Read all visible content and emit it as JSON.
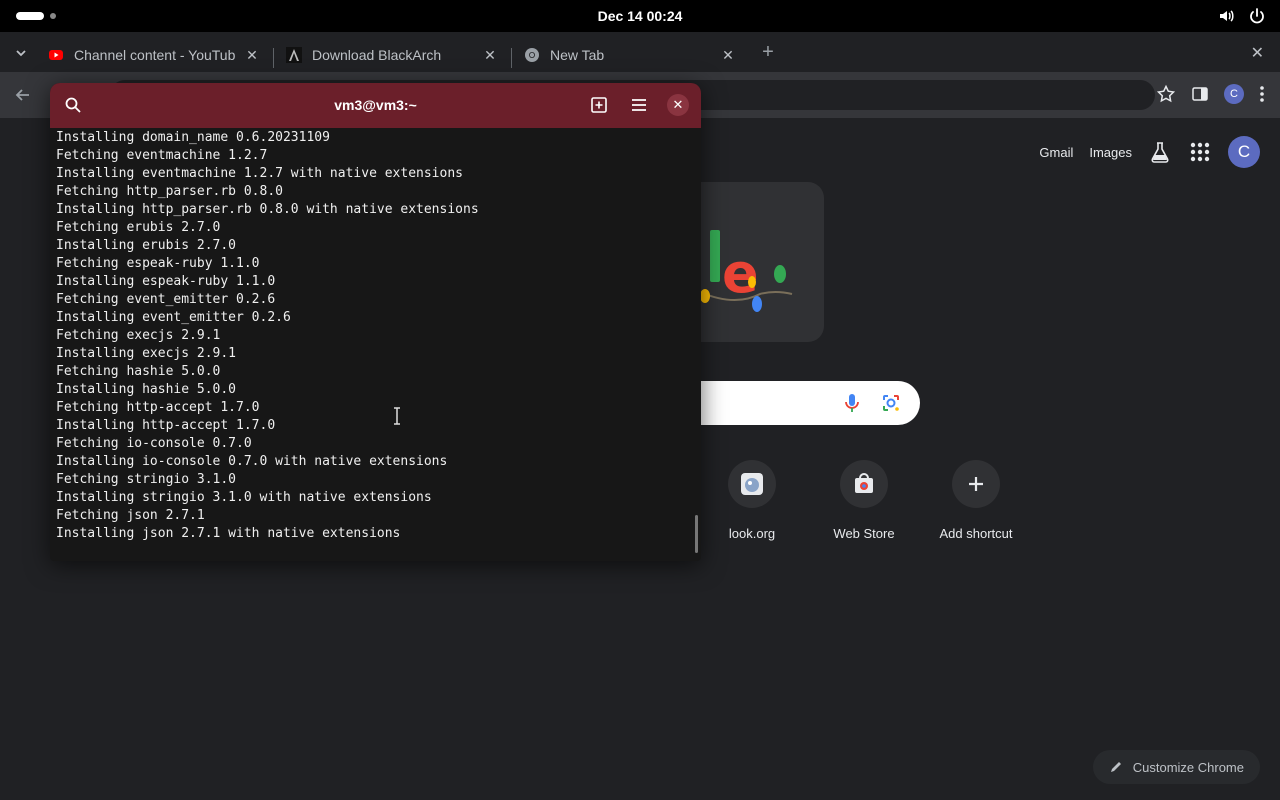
{
  "system": {
    "clock": "Dec 14  00:24"
  },
  "browser": {
    "tabs": [
      {
        "label": "Channel content - YouTube",
        "favicon": "youtube-icon"
      },
      {
        "label": "Download BlackArch",
        "favicon": "blackarch-icon"
      },
      {
        "label": "New Tab",
        "favicon": "chrome-icon"
      }
    ],
    "profile_initial": "C"
  },
  "ntp": {
    "links": {
      "gmail": "Gmail",
      "images": "Images"
    },
    "avatar_initial": "C",
    "shortcuts": [
      {
        "label": "look.org",
        "icon": "gimp-icon"
      },
      {
        "label": "Web Store",
        "icon": "web-store-icon"
      },
      {
        "label": "Add shortcut",
        "icon": "plus-icon"
      }
    ],
    "customize_label": "Customize Chrome"
  },
  "terminal": {
    "title": "vm3@vm3:~",
    "lines": [
      "Installing domain_name 0.6.20231109",
      "Fetching eventmachine 1.2.7",
      "Installing eventmachine 1.2.7 with native extensions",
      "Fetching http_parser.rb 0.8.0",
      "Installing http_parser.rb 0.8.0 with native extensions",
      "Fetching erubis 2.7.0",
      "Installing erubis 2.7.0",
      "Fetching espeak-ruby 1.1.0",
      "Installing espeak-ruby 1.1.0",
      "Fetching event_emitter 0.2.6",
      "Installing event_emitter 0.2.6",
      "Fetching execjs 2.9.1",
      "Installing execjs 2.9.1",
      "Fetching hashie 5.0.0",
      "Installing hashie 5.0.0",
      "Fetching http-accept 1.7.0",
      "Installing http-accept 1.7.0",
      "Fetching io-console 0.7.0",
      "Installing io-console 0.7.0 with native extensions",
      "Fetching stringio 3.1.0",
      "Installing stringio 3.1.0 with native extensions",
      "Fetching json 2.7.1",
      "Installing json 2.7.1 with native extensions"
    ]
  }
}
